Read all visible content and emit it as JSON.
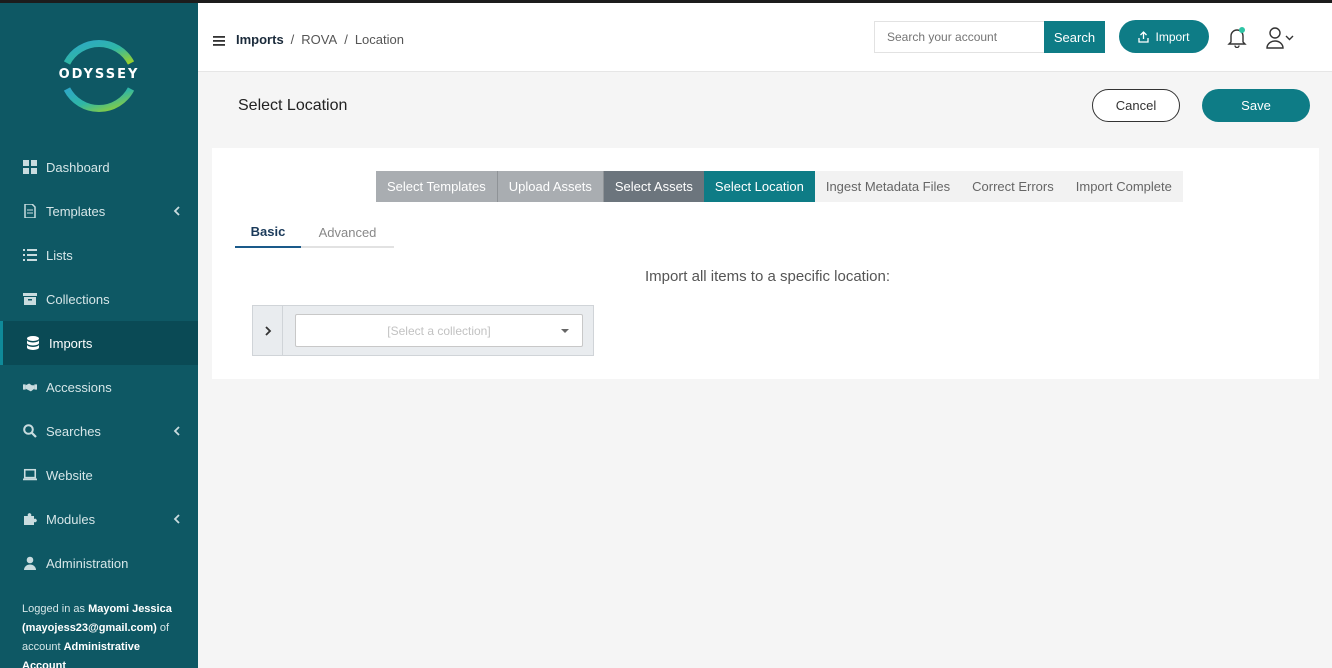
{
  "brand": {
    "name": "ODYSSEY"
  },
  "sidebar": {
    "items": [
      {
        "label": "Dashboard",
        "icon": "dashboard-icon"
      },
      {
        "label": "Templates",
        "icon": "document-icon"
      },
      {
        "label": "Lists",
        "icon": "list-icon"
      },
      {
        "label": "Collections",
        "icon": "archive-icon"
      },
      {
        "label": "Imports",
        "icon": "database-icon"
      },
      {
        "label": "Accessions",
        "icon": "handshake-icon"
      },
      {
        "label": "Searches",
        "icon": "search-icon"
      },
      {
        "label": "Website",
        "icon": "laptop-icon"
      },
      {
        "label": "Modules",
        "icon": "puzzle-icon"
      },
      {
        "label": "Administration",
        "icon": "user-icon"
      }
    ],
    "active": "Imports",
    "logged_in": {
      "prefix": "Logged in as",
      "user": "Mayomi Jessica",
      "email": "(mayojess23@gmail.com)",
      "of": "of",
      "account_prefix": "account",
      "account": "Administrative Account"
    }
  },
  "header": {
    "breadcrumbs": [
      "Imports",
      "/",
      "ROVA",
      "/",
      "Location"
    ],
    "search_placeholder": "Search your account",
    "search_label": "Search",
    "import_label": "Import"
  },
  "page": {
    "title": "Select Location",
    "cancel_label": "Cancel",
    "save_label": "Save"
  },
  "steps": [
    "Select Templates",
    "Upload Assets",
    "Select Assets",
    "Select Location",
    "Ingest Metadata Files",
    "Correct Errors",
    "Import Complete"
  ],
  "tabs": {
    "basic": "Basic",
    "advanced": "Advanced"
  },
  "location": {
    "instruction": "Import all items to a specific location:",
    "select_placeholder": "[Select a collection]"
  },
  "colors": {
    "sidebar": "#0e5864",
    "accent": "#0e7c86",
    "notification": "#2ec4a5"
  }
}
